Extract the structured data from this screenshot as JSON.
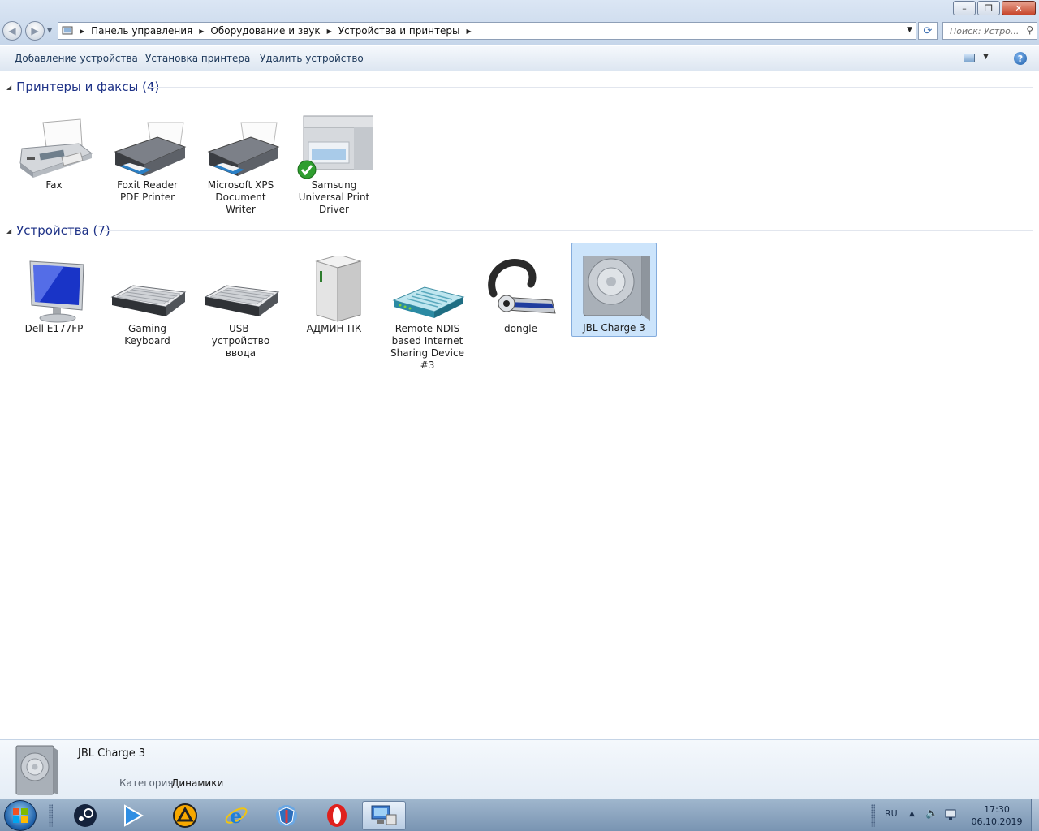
{
  "window": {
    "buttons": {
      "minimize": "–",
      "restore": "❐",
      "close": "✕"
    }
  },
  "address": {
    "crumbs": [
      "Панель управления",
      "Оборудование и звук",
      "Устройства и принтеры"
    ]
  },
  "search": {
    "placeholder": "Поиск: Устро..."
  },
  "commands": {
    "add_device": "Добавление устройства",
    "add_printer": "Установка принтера",
    "remove_device": "Удалить устройство",
    "help": "?"
  },
  "groups": {
    "printers": {
      "title": "Принтеры и факсы (4)",
      "items": [
        {
          "label": "Fax",
          "icon": "fax-icon"
        },
        {
          "label": "Foxit Reader PDF Printer",
          "icon": "printer-icon"
        },
        {
          "label": "Microsoft XPS Document Writer",
          "icon": "printer-icon"
        },
        {
          "label": "Samsung Universal Print Driver",
          "icon": "mfp-printer-icon",
          "default": true
        }
      ]
    },
    "devices": {
      "title": "Устройства (7)",
      "items": [
        {
          "label": "Dell E177FP",
          "icon": "monitor-icon"
        },
        {
          "label": "Gaming Keyboard",
          "icon": "keyboard-icon"
        },
        {
          "label": "USB-устройство ввода",
          "icon": "keyboard-icon"
        },
        {
          "label": "АДМИН-ПК",
          "icon": "computer-tower-icon"
        },
        {
          "label": "Remote NDIS based Internet Sharing Device #3",
          "icon": "network-modem-icon"
        },
        {
          "label": "dongle",
          "icon": "bluetooth-headset-icon"
        },
        {
          "label": "JBL Charge 3",
          "icon": "speaker-icon",
          "selected": true
        }
      ]
    }
  },
  "details": {
    "name": "JBL Charge 3",
    "category_key": "Категория:",
    "category_value": "Динамики"
  },
  "taskbar": {
    "apps": [
      "steam-icon",
      "media-player-icon",
      "aimp-icon",
      "internet-explorer-icon",
      "security-icon",
      "opera-icon",
      "devices-printers-icon"
    ],
    "language": "RU",
    "time": "17:30",
    "date": "06.10.2019"
  },
  "colors": {
    "accent": "#1e3287",
    "selection": "#cce4fb",
    "taskbar": "#8aa4c0"
  }
}
